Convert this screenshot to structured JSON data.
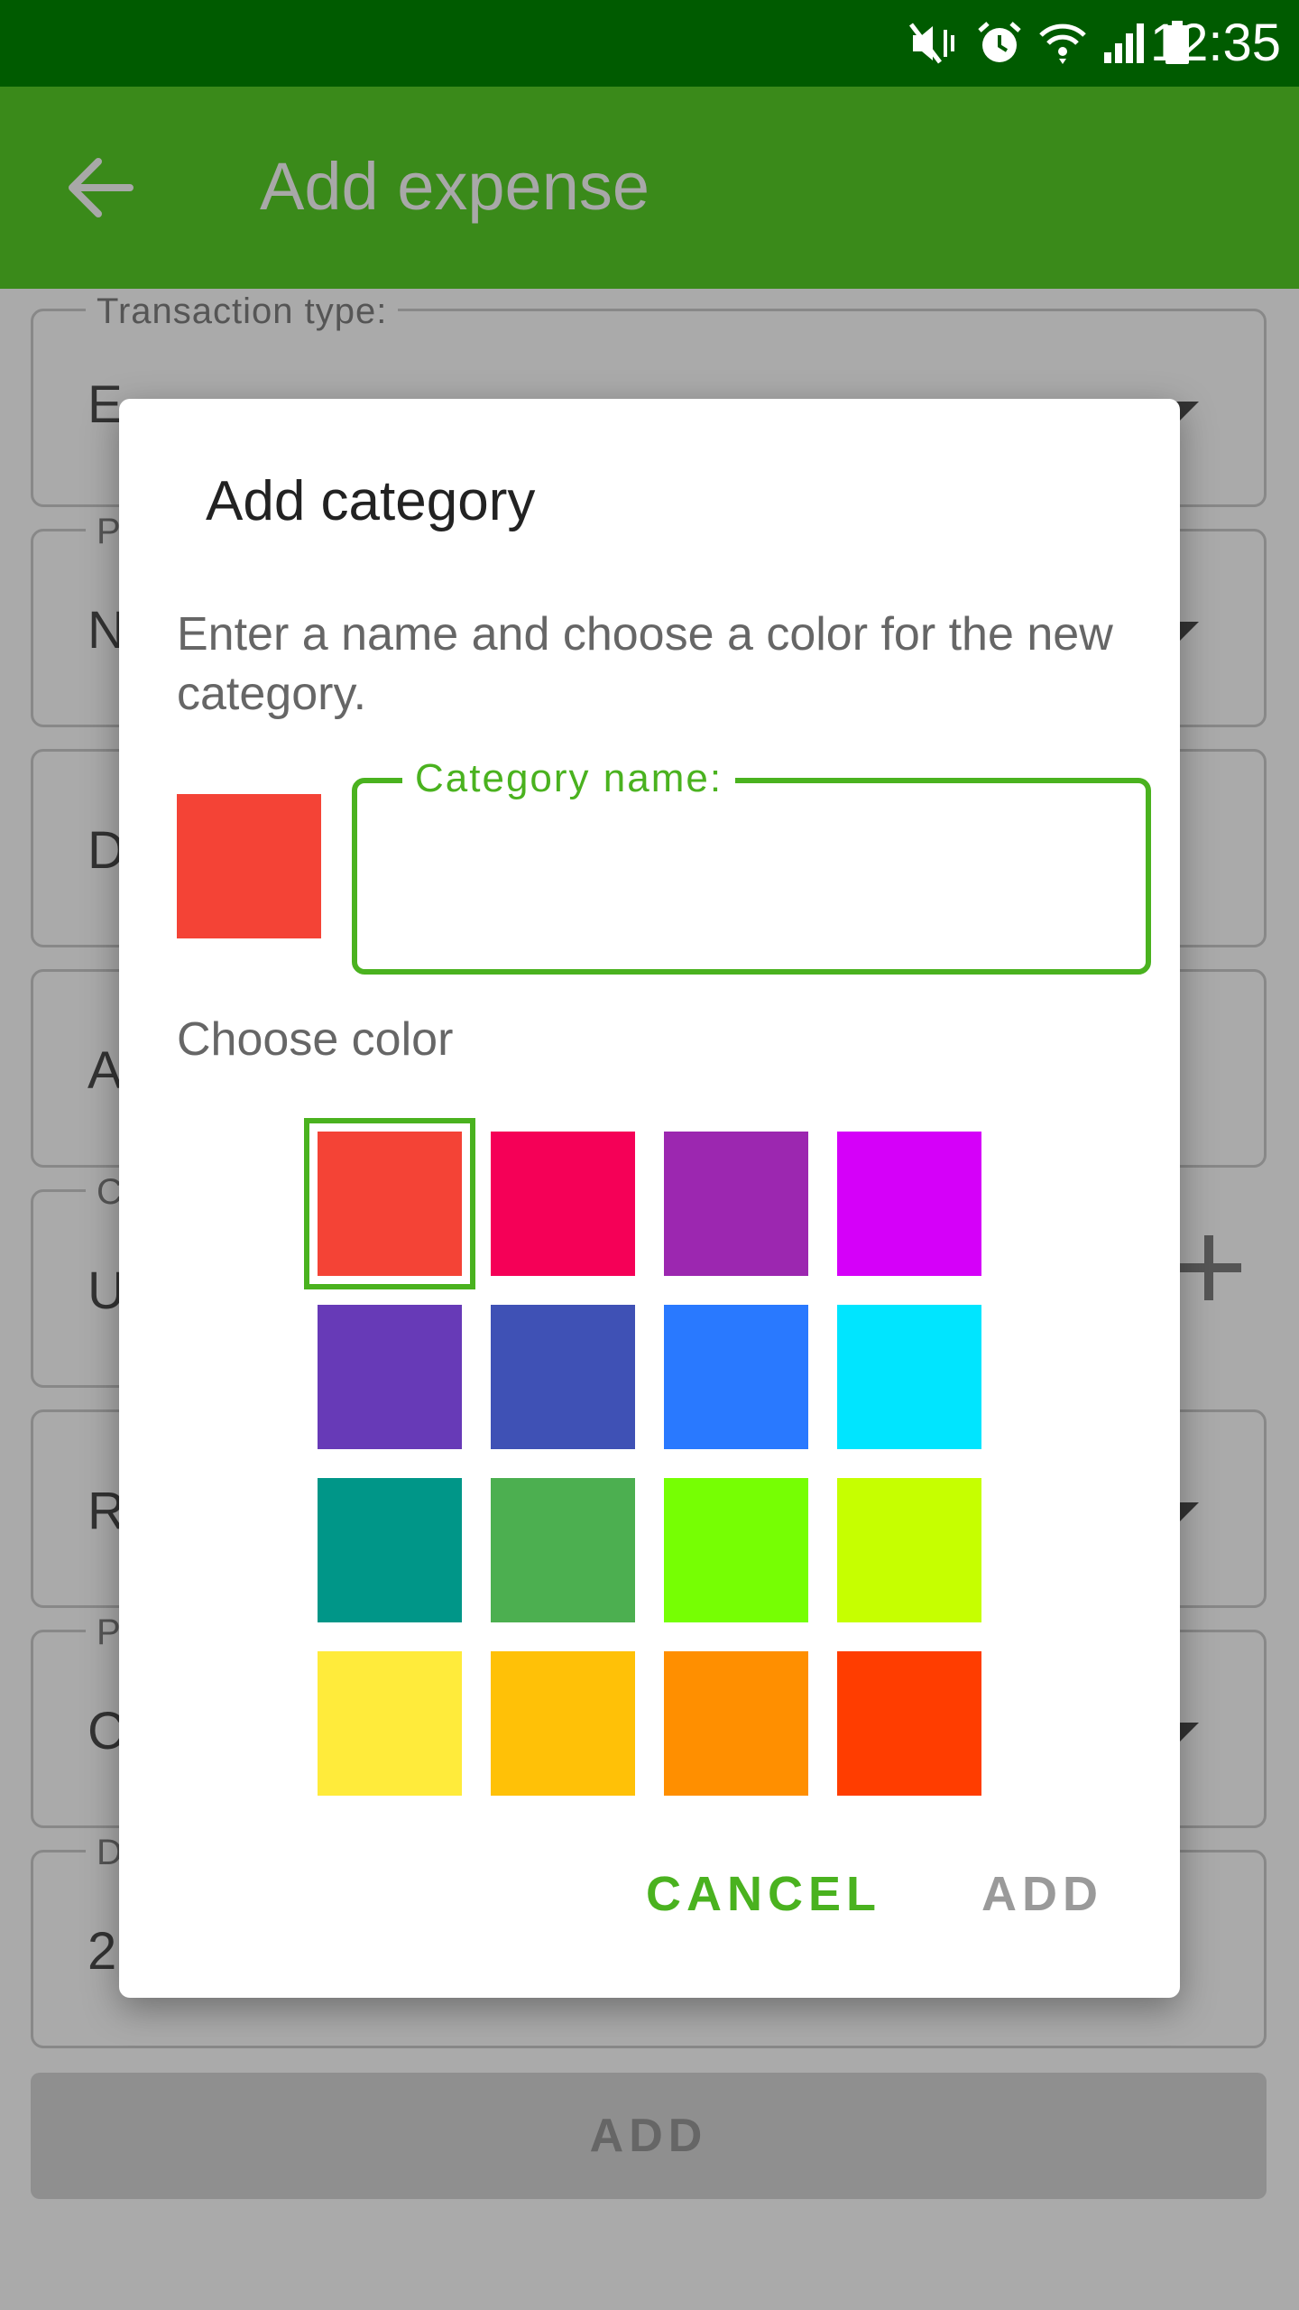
{
  "status_bar": {
    "time": "12:35",
    "icons": [
      "mute-vibrate-icon",
      "alarm-icon",
      "wifi-icon",
      "signal-icon",
      "battery-icon"
    ]
  },
  "app_bar": {
    "title": "Add expense",
    "back_icon": "back-arrow-icon"
  },
  "background_form": {
    "fields": [
      {
        "label": "Transaction type:",
        "value": "E"
      },
      {
        "label": "P",
        "value": "N"
      },
      {
        "label": "",
        "value": "D"
      },
      {
        "label": "",
        "value": "A"
      },
      {
        "label": "C",
        "value": "U"
      },
      {
        "label": "",
        "value": "R"
      },
      {
        "label": "P",
        "value": "C"
      },
      {
        "label": "D",
        "value": "2"
      }
    ],
    "add_button": "ADD"
  },
  "dialog": {
    "title": "Add category",
    "message": "Enter a name and choose a color for the new category.",
    "name_field_label": "Category name:",
    "name_value": "",
    "choose_color_label": "Choose color",
    "selected_color": "#F44336",
    "colors": [
      "#F44336",
      "#F50057",
      "#9C27B0",
      "#D500F9",
      "#673AB7",
      "#3F51B5",
      "#2979FF",
      "#00E5FF",
      "#009688",
      "#4CAF50",
      "#76FF03",
      "#C6FF00",
      "#FFEB3B",
      "#FFC107",
      "#FF8F00",
      "#FF3D00"
    ],
    "cancel_label": "CANCEL",
    "add_label": "ADD"
  },
  "theme": {
    "status_bar": "#005b00",
    "app_bar": "#3a8a1a",
    "accent": "#4ab21f"
  }
}
